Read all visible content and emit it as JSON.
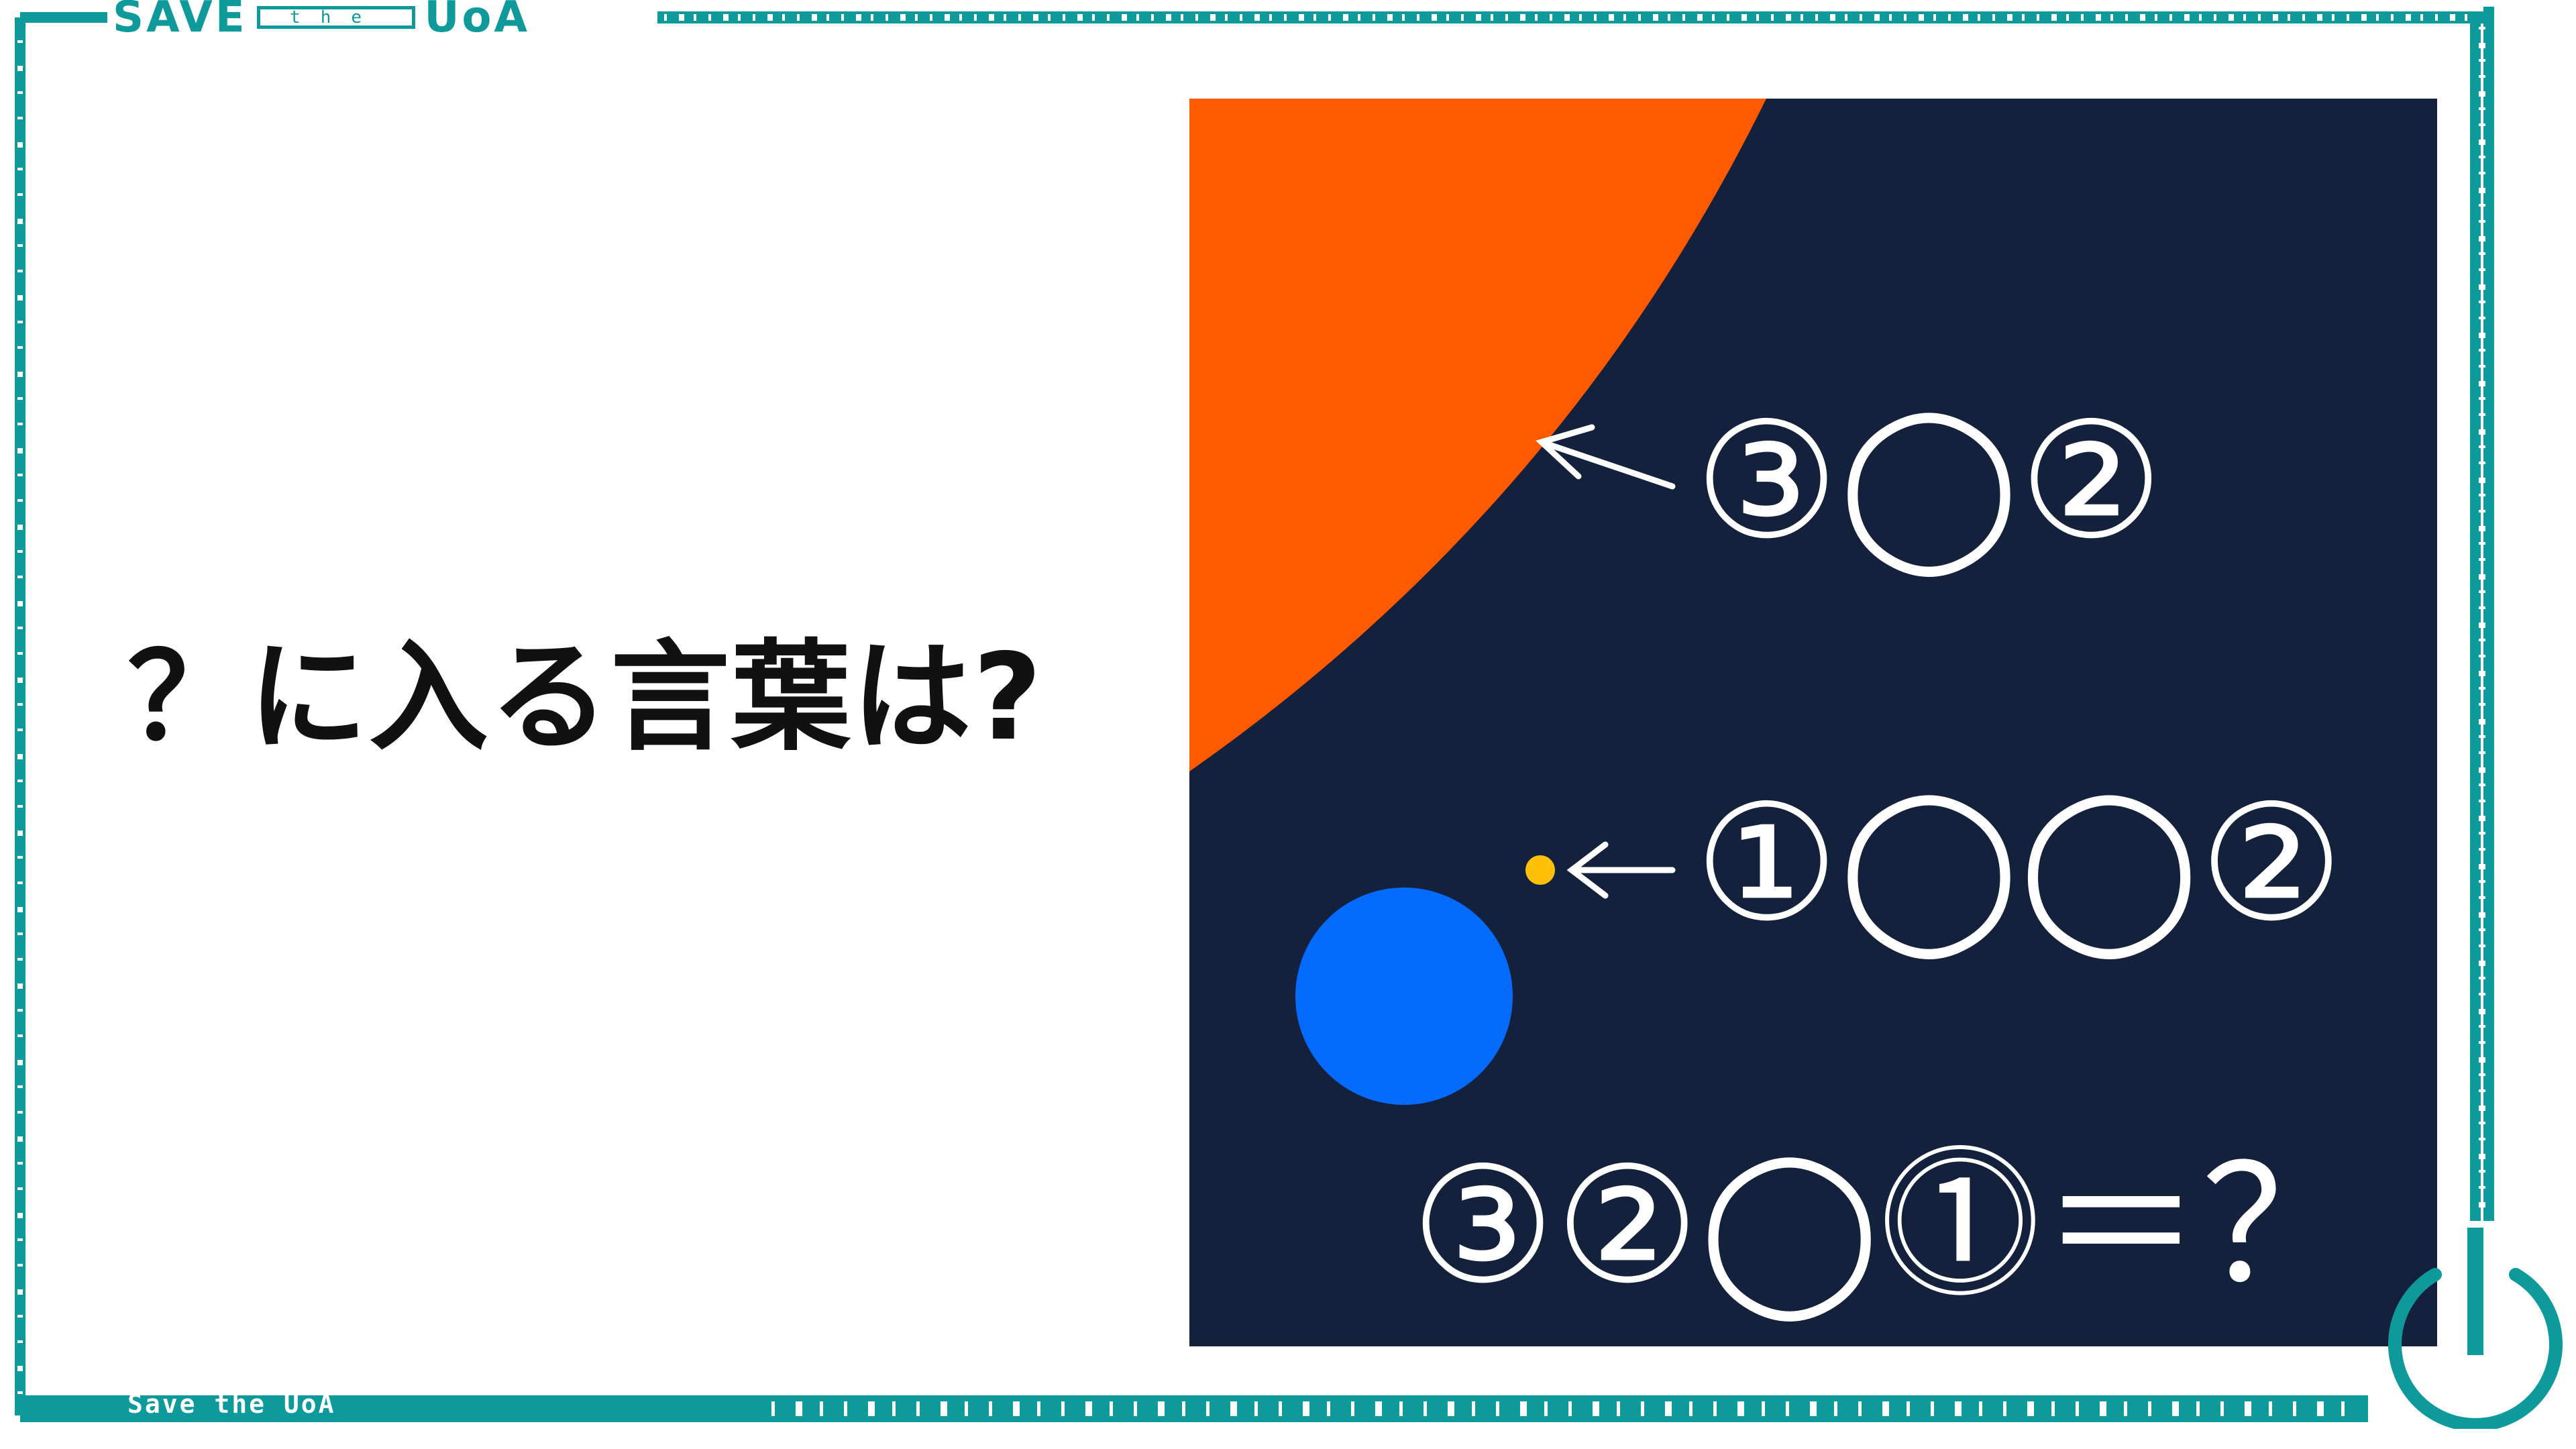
{
  "header": {
    "brand_word_1": "SAVE",
    "brand_word_2": "the",
    "brand_word_3": "UoA"
  },
  "footer": {
    "brand_label": "Save the UoA"
  },
  "colors": {
    "frame_teal": "#0e9a9a",
    "panel_navy": "#14213d",
    "sun_orange": "#ff5a00",
    "earth_blue": "#056bfd",
    "moon_yellow": "#ffc107",
    "text_white": "#ffffff",
    "text_black": "#111111"
  },
  "puzzle": {
    "question": "？に入る言葉は?",
    "clue_sun": "③◯②",
    "clue_moon": "①◯◯②",
    "equation": "③②◯⓵＝？"
  },
  "icons": {
    "power": "power-button-icon",
    "arrow": "left-arrow-icon"
  }
}
